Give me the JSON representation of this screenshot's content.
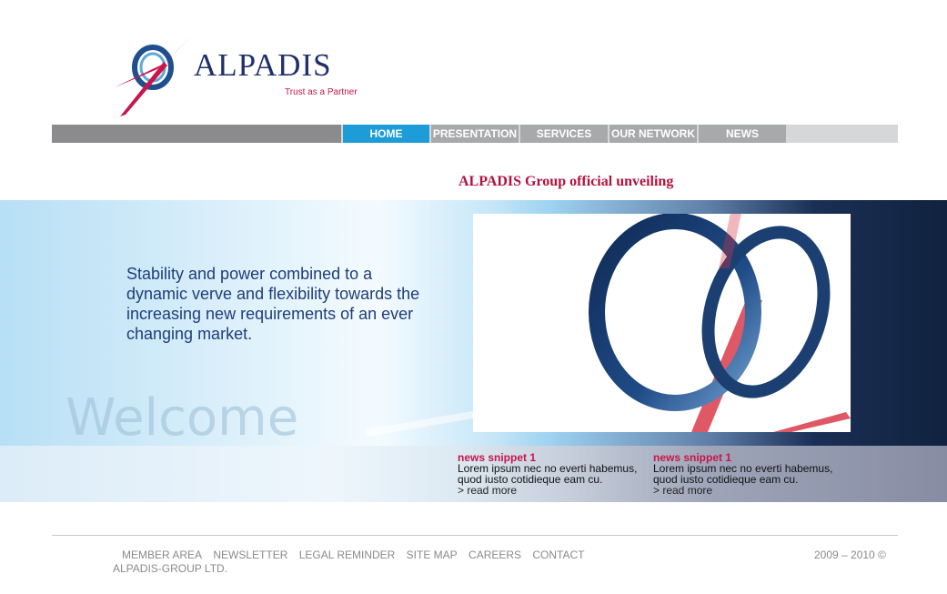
{
  "logo": {
    "wordmark": "ALPADIS",
    "tagline": "Trust as a Partner"
  },
  "nav": {
    "items": [
      {
        "label": "HOME",
        "active": true
      },
      {
        "label": "PRESENTATION",
        "active": false
      },
      {
        "label": "SERVICES",
        "active": false
      },
      {
        "label": "OUR NETWORK",
        "active": false
      },
      {
        "label": "NEWS",
        "active": false
      }
    ]
  },
  "headline": "ALPADIS Group official unveiling",
  "hero": {
    "text": "Stability and power combined to a dynamic verve and flexibility towards the increasing new requirements of an ever changing market.",
    "watermark": "Welcome"
  },
  "news": [
    {
      "title": "news snippet 1",
      "body": "Lorem ipsum nec no everti habemus, quod iusto cotidieque eam cu.",
      "more": "> read more"
    },
    {
      "title": "news snippet 1",
      "body": "Lorem ipsum nec no everti habemus, quod iusto cotidieque eam cu.",
      "more": "> read more"
    }
  ],
  "footer": {
    "links": [
      "MEMBER AREA",
      "NEWSLETTER",
      "LEGAL REMINDER",
      "SITE MAP",
      "CAREERS",
      "CONTACT"
    ],
    "company": "ALPADIS-GROUP LTD.",
    "copyright": "2009 – 2010 ©"
  },
  "colors": {
    "brand_navy": "#1f2f6b",
    "brand_red": "#c8164b",
    "nav_active": "#1d9cd8",
    "nav_gray": "#a8a9ab"
  }
}
